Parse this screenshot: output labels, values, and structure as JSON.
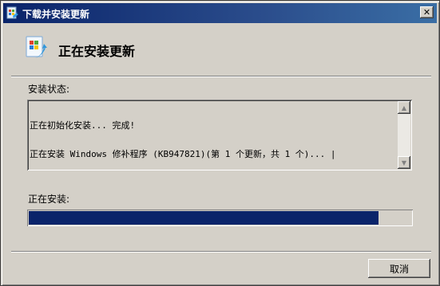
{
  "window": {
    "title": "下载并安装更新",
    "close_glyph": "✕"
  },
  "header": {
    "title": "正在安装更新",
    "icon": "windows-update-icon"
  },
  "status": {
    "label": "安装状态:",
    "lines": [
      "正在初始化安装... 完成!",
      "正在安装 Windows 修补程序 (KB947821)(第 1 个更新，共 1 个)... |"
    ]
  },
  "progress": {
    "label": "正在安装:",
    "fraction": 0.915,
    "color": "#0a246a"
  },
  "buttons": {
    "cancel_label": "取消"
  },
  "scrollbar": {
    "up_glyph": "▲",
    "down_glyph": "▼"
  }
}
